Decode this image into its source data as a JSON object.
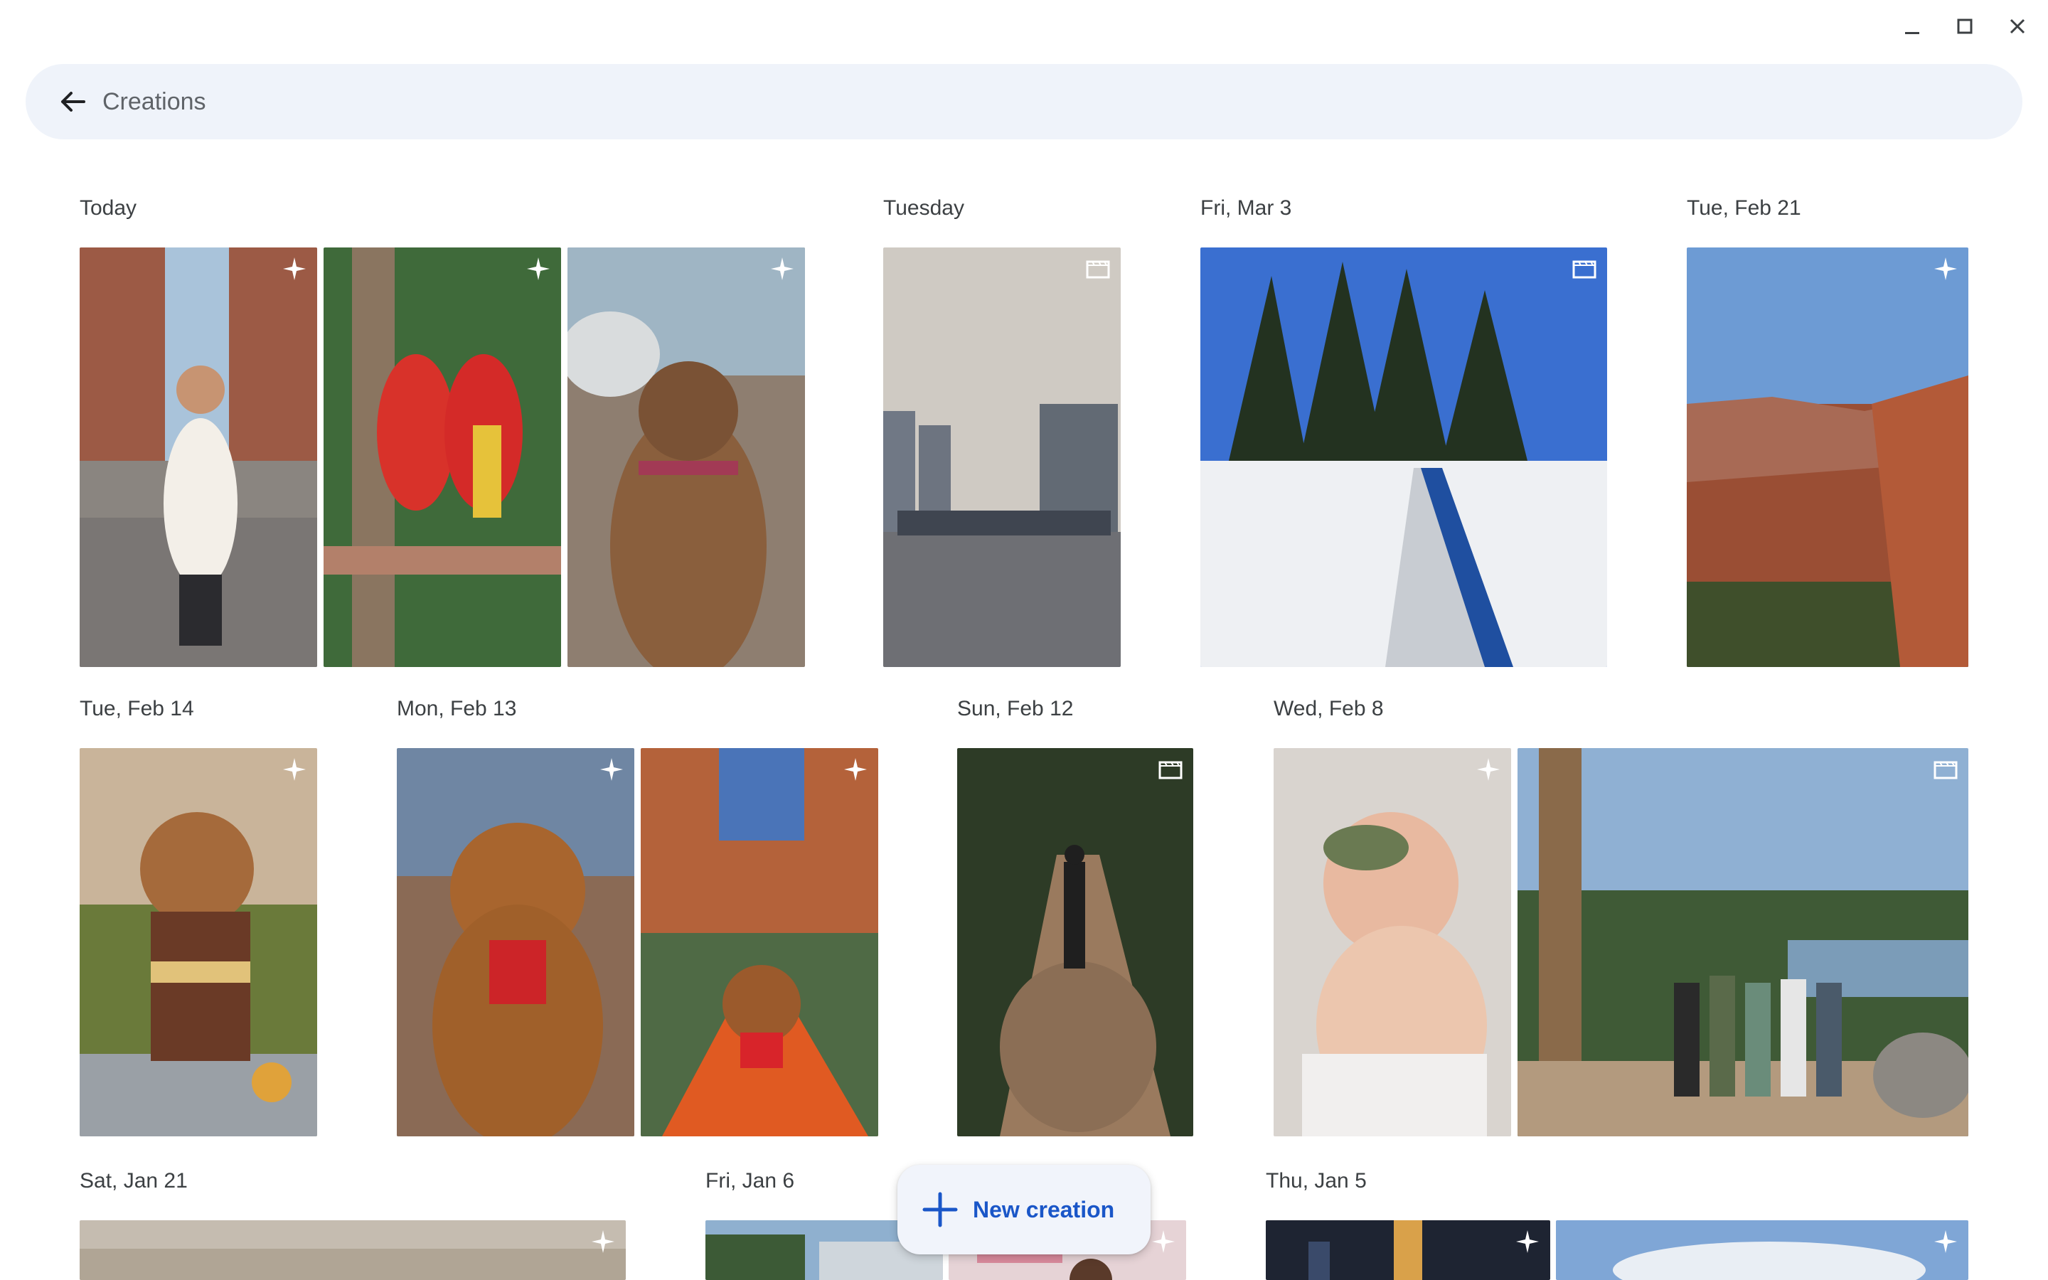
{
  "window": {
    "minimize_icon": "minimize-icon",
    "maximize_icon": "maximize-icon",
    "close_icon": "close-icon"
  },
  "header": {
    "back_icon": "arrow-back-icon",
    "title": "Creations"
  },
  "groups": [
    {
      "date": "Today",
      "items": [
        {
          "subject": "woman on city street",
          "badge": "sparkle"
        },
        {
          "subject": "two macaws",
          "badge": "sparkle"
        },
        {
          "subject": "dog back view",
          "badge": "sparkle"
        }
      ]
    },
    {
      "date": "Tuesday",
      "items": [
        {
          "subject": "city skyline over water",
          "badge": "video"
        }
      ]
    },
    {
      "date": "Fri, Mar 3",
      "items": [
        {
          "subject": "snowy dock with trees",
          "badge": "video"
        }
      ]
    },
    {
      "date": "Tue, Feb 21",
      "items": [
        {
          "subject": "canyon landscape",
          "badge": "sparkle"
        }
      ]
    },
    {
      "date": "Tue, Feb 14",
      "items": [
        {
          "subject": "dog in pirate costume",
          "badge": "sparkle"
        }
      ]
    },
    {
      "date": "Mon, Feb 13",
      "items": [
        {
          "subject": "poodle in canyon",
          "badge": "sparkle"
        },
        {
          "subject": "dog on kayak",
          "badge": "sparkle"
        }
      ]
    },
    {
      "date": "Sun, Feb 12",
      "items": [
        {
          "subject": "woman walking on muddy path",
          "badge": "video"
        }
      ]
    },
    {
      "date": "Wed, Feb 8",
      "items": [
        {
          "subject": "baby with headband",
          "badge": "sparkle"
        },
        {
          "subject": "group hiking by lake",
          "badge": "video"
        }
      ]
    },
    {
      "date": "Sat, Jan 21",
      "items": [
        {
          "subject": "beach",
          "badge": "sparkle"
        }
      ]
    },
    {
      "date": "Fri, Jan 6",
      "items": [
        {
          "subject": "outdoor scene",
          "badge": ""
        },
        {
          "subject": "pink scene",
          "badge": "sparkle"
        }
      ]
    },
    {
      "date": "Thu, Jan 5",
      "items": [
        {
          "subject": "night city",
          "badge": "sparkle"
        },
        {
          "subject": "sky",
          "badge": "sparkle"
        }
      ]
    }
  ],
  "fab": {
    "icon": "plus-icon",
    "label": "New creation"
  },
  "colors": {
    "header_bg": "#eff3fa",
    "accent": "#1a56c8",
    "text": "#3c4043"
  }
}
